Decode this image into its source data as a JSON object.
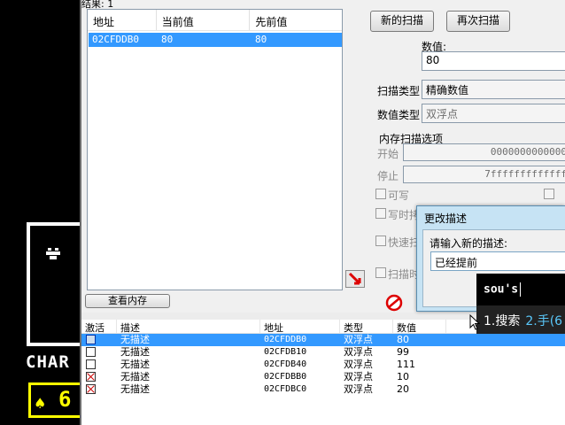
{
  "game": {
    "text": "CHAR",
    "stat_value": "6"
  },
  "results": {
    "label": "结果: 1",
    "columns": [
      "地址",
      "当前值",
      "先前值"
    ],
    "rows": [
      {
        "address": "02CFDDB0",
        "current": "80",
        "previous": "80"
      }
    ]
  },
  "scan": {
    "new_scan_label": "新的扫描",
    "next_scan_label": "再次扫描",
    "value_label": "数值:",
    "value": "80",
    "scan_type_label": "扫描类型",
    "scan_type_value": "精确数值",
    "value_type_label": "数值类型",
    "value_type_value": "双浮点",
    "mem_options_label": "内存扫描选项",
    "start_label": "开始",
    "start_value": "0000000000000",
    "stop_label": "停止",
    "stop_value": "7fffffffffffff",
    "writable_label": "可写",
    "copy_on_write_label": "写时拷",
    "fast_scan_label": "快速扫",
    "scan_when_label": "扫描时",
    "view_memory_label": "查看内存"
  },
  "address_table": {
    "columns": [
      "激活",
      "描述",
      "地址",
      "类型",
      "数值"
    ],
    "rows": [
      {
        "active": false,
        "description": "无描述",
        "address": "02CFDDB0",
        "type": "双浮点",
        "value": "80"
      },
      {
        "active": false,
        "description": "无描述",
        "address": "02CFDB10",
        "type": "双浮点",
        "value": "99"
      },
      {
        "active": false,
        "description": "无描述",
        "address": "02CFDB40",
        "type": "双浮点",
        "value": "111"
      },
      {
        "active": true,
        "description": "无描述",
        "address": "02CFDBB0",
        "type": "双浮点",
        "value": "10"
      },
      {
        "active": true,
        "description": "无描述",
        "address": "02CFDBC0",
        "type": "双浮点",
        "value": "20"
      }
    ]
  },
  "dialog": {
    "title": "更改描述",
    "prompt": "请输入新的描述:",
    "input_value": "已经提前"
  },
  "ime": {
    "composition": "sou's",
    "candidate_1": "1.搜索",
    "candidate_2": "2.手(6"
  },
  "colors": {
    "selection": "#3399ff",
    "dialog_frame": "#c6e3f4",
    "game_text": "#ffffff",
    "game_stat": "#ffff00"
  }
}
